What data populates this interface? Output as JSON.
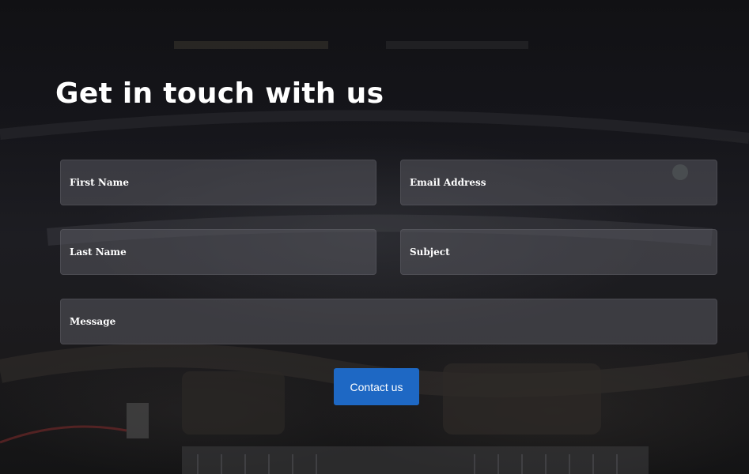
{
  "heading": "Get in touch with us",
  "form": {
    "first_name": {
      "placeholder": "First Name",
      "value": ""
    },
    "email": {
      "placeholder": "Email Address",
      "value": ""
    },
    "last_name": {
      "placeholder": "Last Name",
      "value": ""
    },
    "subject": {
      "placeholder": "Subject",
      "value": ""
    },
    "message": {
      "placeholder": "Message",
      "value": ""
    },
    "submit_label": "Contact us"
  },
  "colors": {
    "background": "#0f0f13",
    "heading": "#ffffff",
    "field_fill": "#4c4c52",
    "button": "#1e68c4",
    "button_text": "#ffffff"
  }
}
